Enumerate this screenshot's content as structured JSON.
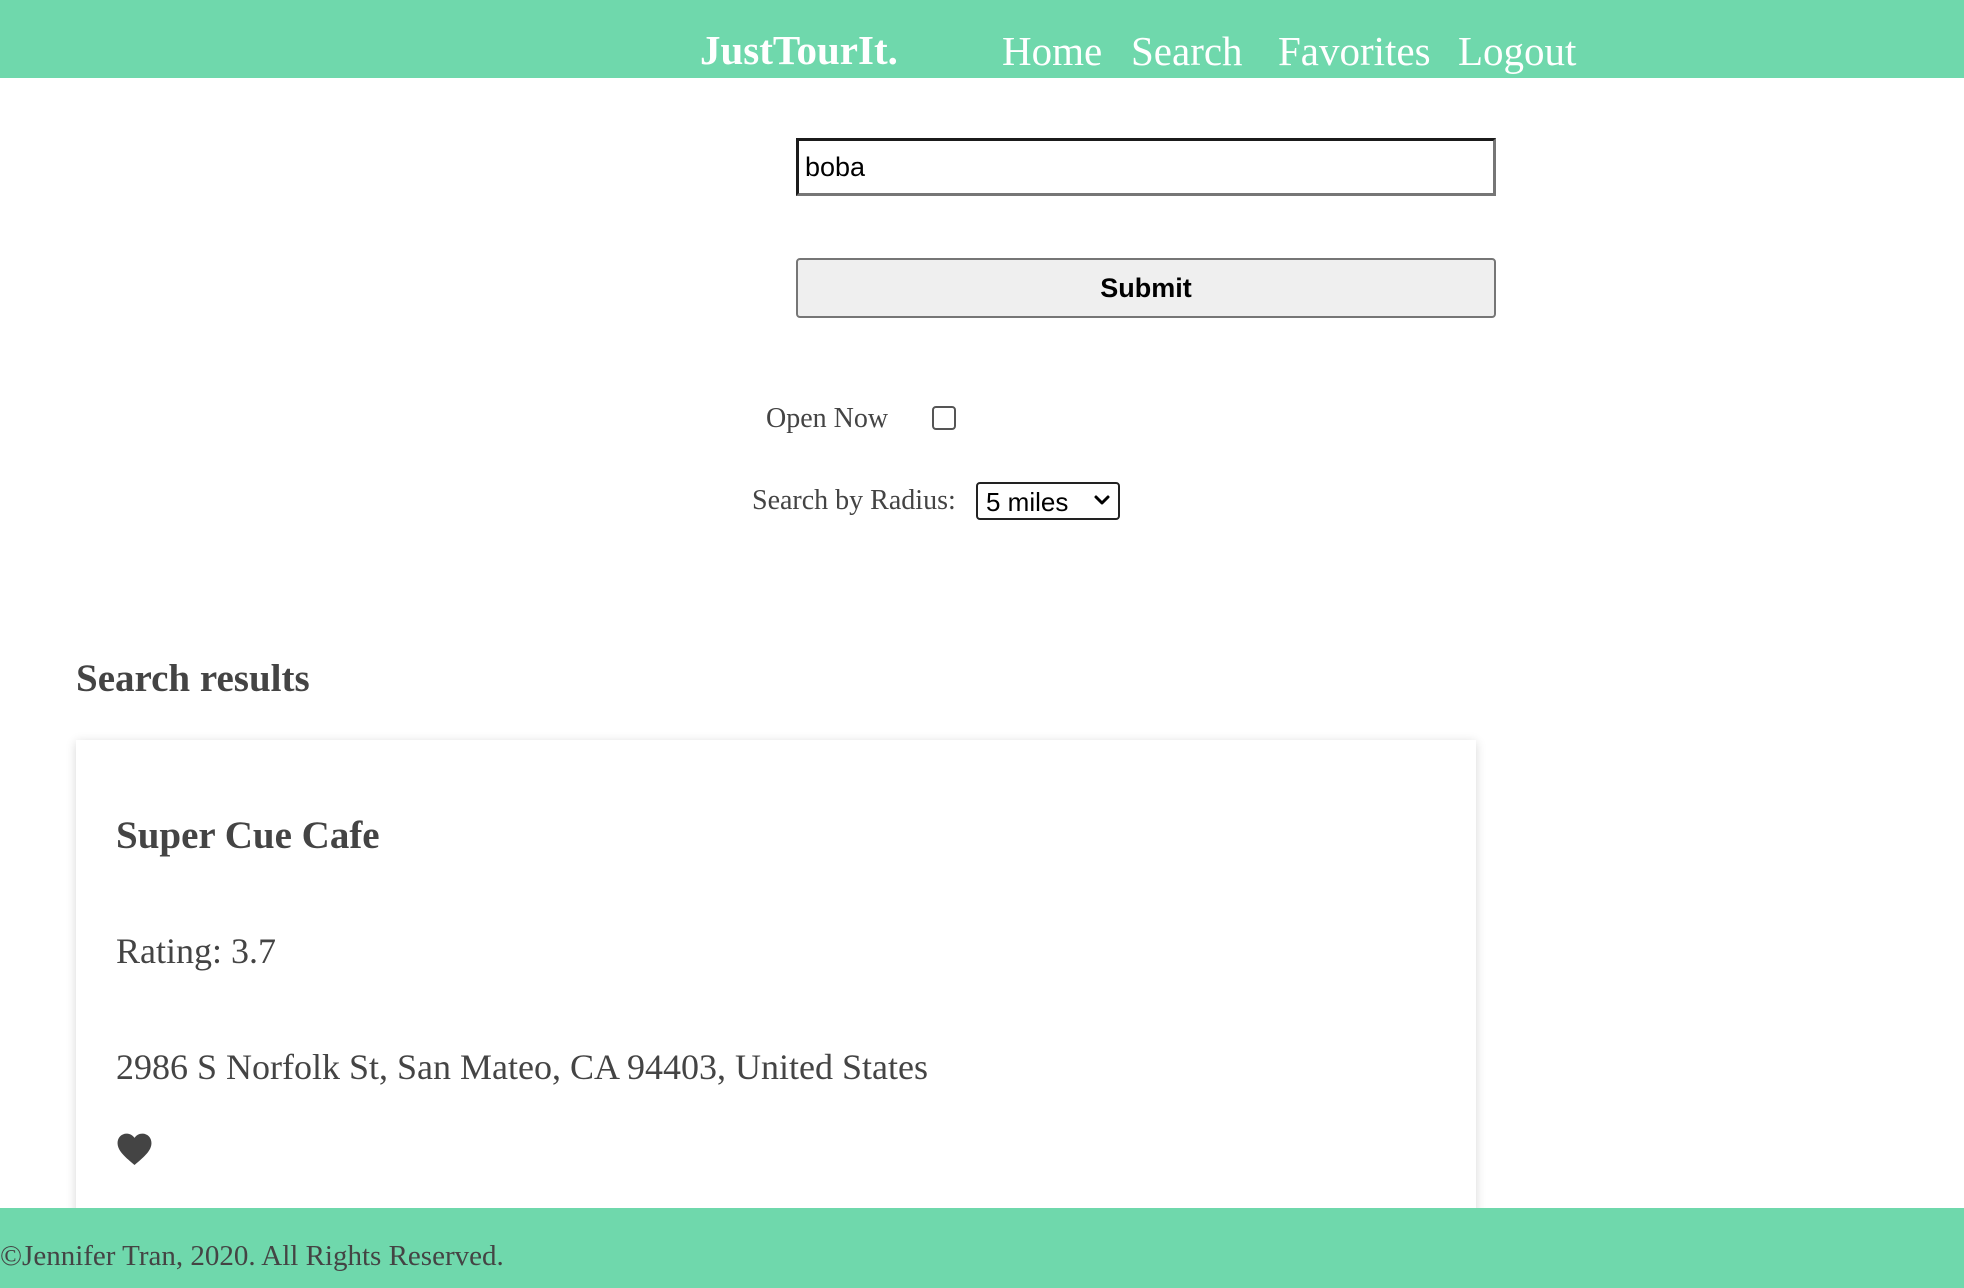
{
  "navbar": {
    "brand": "JustTourIt.",
    "links": {
      "home": "Home",
      "search": "Search",
      "favorites": "Favorites",
      "logout": "Logout"
    }
  },
  "search_form": {
    "query_value": "boba",
    "submit_label": "Submit",
    "open_now_label": "Open Now",
    "open_now_checked": false,
    "radius_label": "Search by Radius:",
    "radius_selected": "5 miles"
  },
  "results": {
    "heading": "Search results",
    "items": [
      {
        "name": "Super Cue Cafe",
        "rating_text": "Rating: 3.7",
        "address": "2986 S Norfolk St, San Mateo, CA 94403, United States",
        "favorite_icon": "heart-icon"
      }
    ]
  },
  "footer": {
    "copyright": "©Jennifer Tran, 2020. All Rights Reserved."
  },
  "colors": {
    "brand_green": "#6fd8ac",
    "text_dark": "#444444"
  }
}
